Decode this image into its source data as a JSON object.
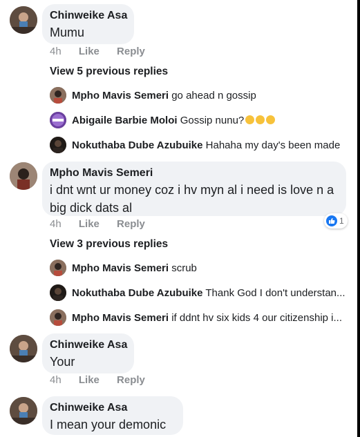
{
  "comments": [
    {
      "author": "Chinweike Asa",
      "text": "Mumu",
      "time": "4h",
      "like": "Like",
      "reply": "Reply"
    },
    {
      "author": "Mpho Mavis Semeri",
      "text": "i dnt wnt ur money coz i hv myn al i need is love n a big dick dats al",
      "time": "4h",
      "like": "Like",
      "reply": "Reply",
      "reaction_count": "1"
    },
    {
      "author": "Chinweike Asa",
      "text": "Your",
      "time": "4h",
      "like": "Like",
      "reply": "Reply"
    },
    {
      "author": "Chinweike Asa",
      "text": "I mean your demonic"
    }
  ],
  "thread1": {
    "view_previous": "View 5 previous replies",
    "replies": [
      {
        "author": "Mpho Mavis Semeri",
        "text": "go ahead n gossip"
      },
      {
        "author": "Abigaile Barbie Moloi",
        "text": "Gossip nunu?"
      },
      {
        "author": "Nokuthaba Dube Azubuike",
        "text": "Hahaha my day's been made"
      }
    ]
  },
  "thread2": {
    "view_previous": "View 3 previous replies",
    "replies": [
      {
        "author": "Mpho Mavis Semeri",
        "text": "scrub"
      },
      {
        "author": "Nokuthaba Dube Azubuike",
        "text": "Thank God I don't understan..."
      },
      {
        "author": "Mpho Mavis Semeri",
        "text": "if ddnt hv six kids 4 our citizenship i..."
      }
    ]
  },
  "icons": {
    "reaction": "like-icon",
    "emoji": "laughing-emoji-icon"
  },
  "colors": {
    "bubble": "#f0f2f5",
    "meta_gray": "#8a8d91",
    "like_blue": "#1877f2"
  }
}
